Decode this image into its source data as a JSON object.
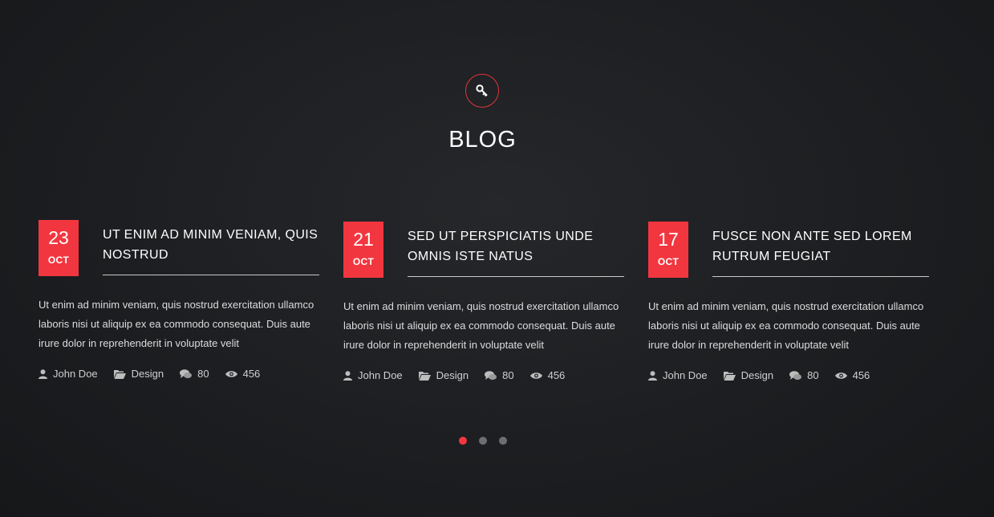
{
  "section": {
    "icon": "key-icon",
    "title": "BLOG"
  },
  "colors": {
    "accent": "#f2363f",
    "background": "#1c1e21",
    "dot_inactive": "#6d6e70"
  },
  "posts": [
    {
      "day": "23",
      "month": "OCT",
      "title": "UT ENIM AD MINIM VENIAM, QUIS NOSTRUD",
      "excerpt": "Ut enim ad minim veniam, quis nostrud exercitation ullamco laboris nisi ut aliquip ex ea commodo consequat. Duis aute irure dolor in reprehenderit in voluptate velit",
      "author": "John Doe",
      "category": "Design",
      "comments": "80",
      "views": "456"
    },
    {
      "day": "21",
      "month": "OCT",
      "title": "SED UT PERSPICIATIS UNDE OMNIS ISTE NATUS",
      "excerpt": "Ut enim ad minim veniam, quis nostrud exercitation ullamco laboris nisi ut aliquip ex ea commodo consequat. Duis aute irure dolor in reprehenderit in voluptate velit",
      "author": "John Doe",
      "category": "Design",
      "comments": "80",
      "views": "456"
    },
    {
      "day": "17",
      "month": "OCT",
      "title": "FUSCE NON ANTE SED LOREM RUTRUM FEUGIAT",
      "excerpt": "Ut enim ad minim veniam, quis nostrud exercitation ullamco laboris nisi ut aliquip ex ea commodo consequat. Duis aute irure dolor in reprehenderit in voluptate velit",
      "author": "John Doe",
      "category": "Design",
      "comments": "80",
      "views": "456"
    }
  ],
  "pagination": {
    "total": 3,
    "active": 1
  }
}
